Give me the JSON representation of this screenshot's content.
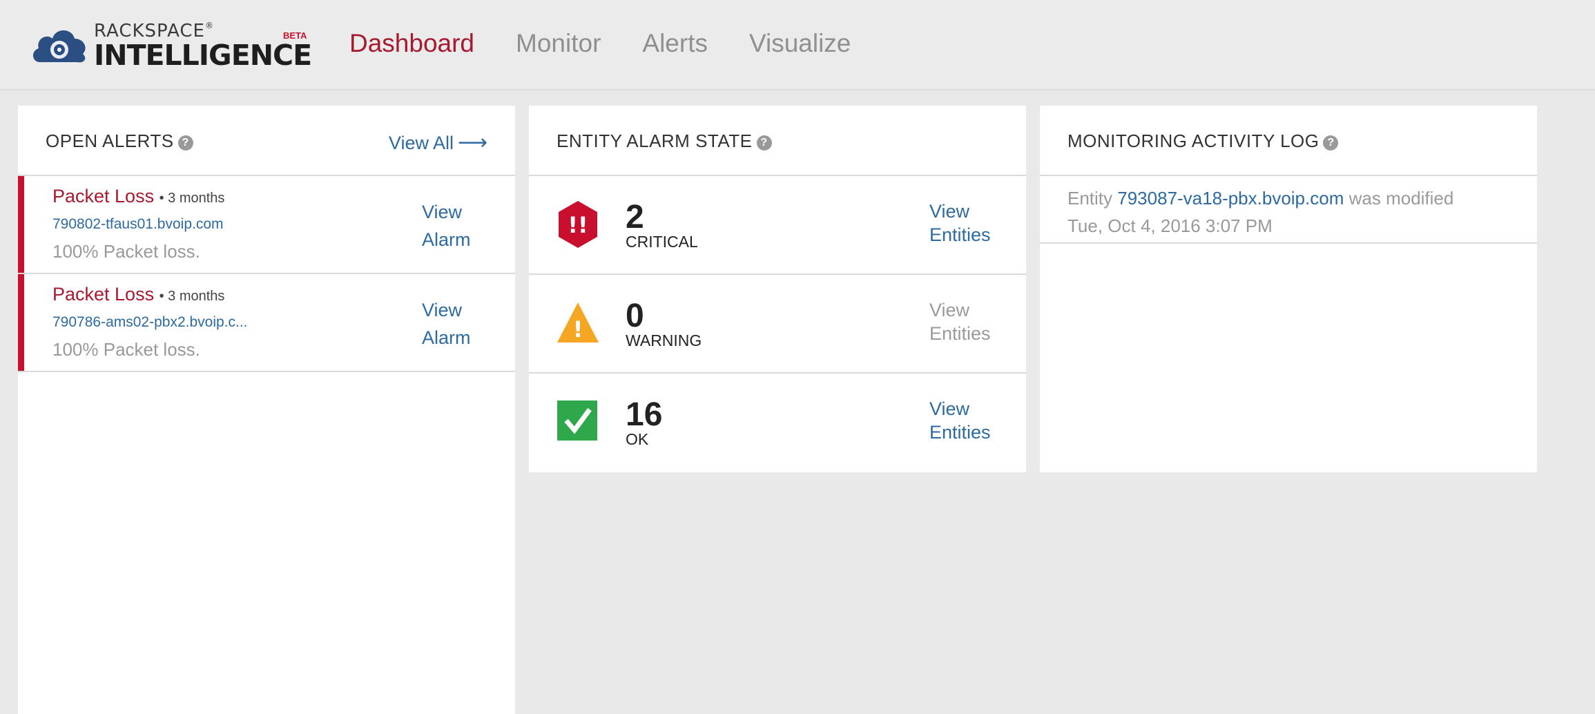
{
  "brand": {
    "top": "RACKSPACE",
    "reg": "®",
    "main": "INTELLIGENCE",
    "beta": "BETA"
  },
  "nav": [
    {
      "label": "Dashboard",
      "active": true
    },
    {
      "label": "Monitor",
      "active": false
    },
    {
      "label": "Alerts",
      "active": false
    },
    {
      "label": "Visualize",
      "active": false
    }
  ],
  "open_alerts": {
    "title": "OPEN ALERTS",
    "view_all": "View All",
    "items": [
      {
        "title": "Packet Loss",
        "time": "• 3 months",
        "host": "790802-tfaus01.bvoip.com",
        "desc": "100% Packet loss.",
        "view": "View Alarm"
      },
      {
        "title": "Packet Loss",
        "time": "• 3 months",
        "host": "790786-ams02-pbx2.bvoip.c...",
        "desc": "100% Packet loss.",
        "view": "View Alarm"
      }
    ]
  },
  "entity_alarm": {
    "title": "ENTITY ALARM STATE",
    "states": [
      {
        "count": "2",
        "label": "CRITICAL",
        "view": "View Entities",
        "icon": "critical-icon",
        "color": "#c8102e"
      },
      {
        "count": "0",
        "label": "WARNING",
        "view": "View Entities",
        "icon": "warning-icon",
        "color": "#f5a623"
      },
      {
        "count": "16",
        "label": "OK",
        "view": "View Entities",
        "icon": "check-icon",
        "color": "#2ea84a"
      }
    ]
  },
  "activity_log": {
    "title": "MONITORING ACTIVITY LOG",
    "entries": [
      {
        "prefix": "Entity",
        "entity": "793087-va18-pbx.bvoip.com",
        "suffix": "was modified",
        "timestamp": "Tue, Oct 4, 2016 3:07 PM"
      }
    ]
  },
  "icons": {
    "help": "?",
    "arrow": "⟶",
    "critical_glyph": "!!",
    "warning_glyph": "!"
  },
  "colors": {
    "accent_red": "#a6192e",
    "link_blue": "#2c6aa0",
    "alert_bar": "#c8102e"
  }
}
